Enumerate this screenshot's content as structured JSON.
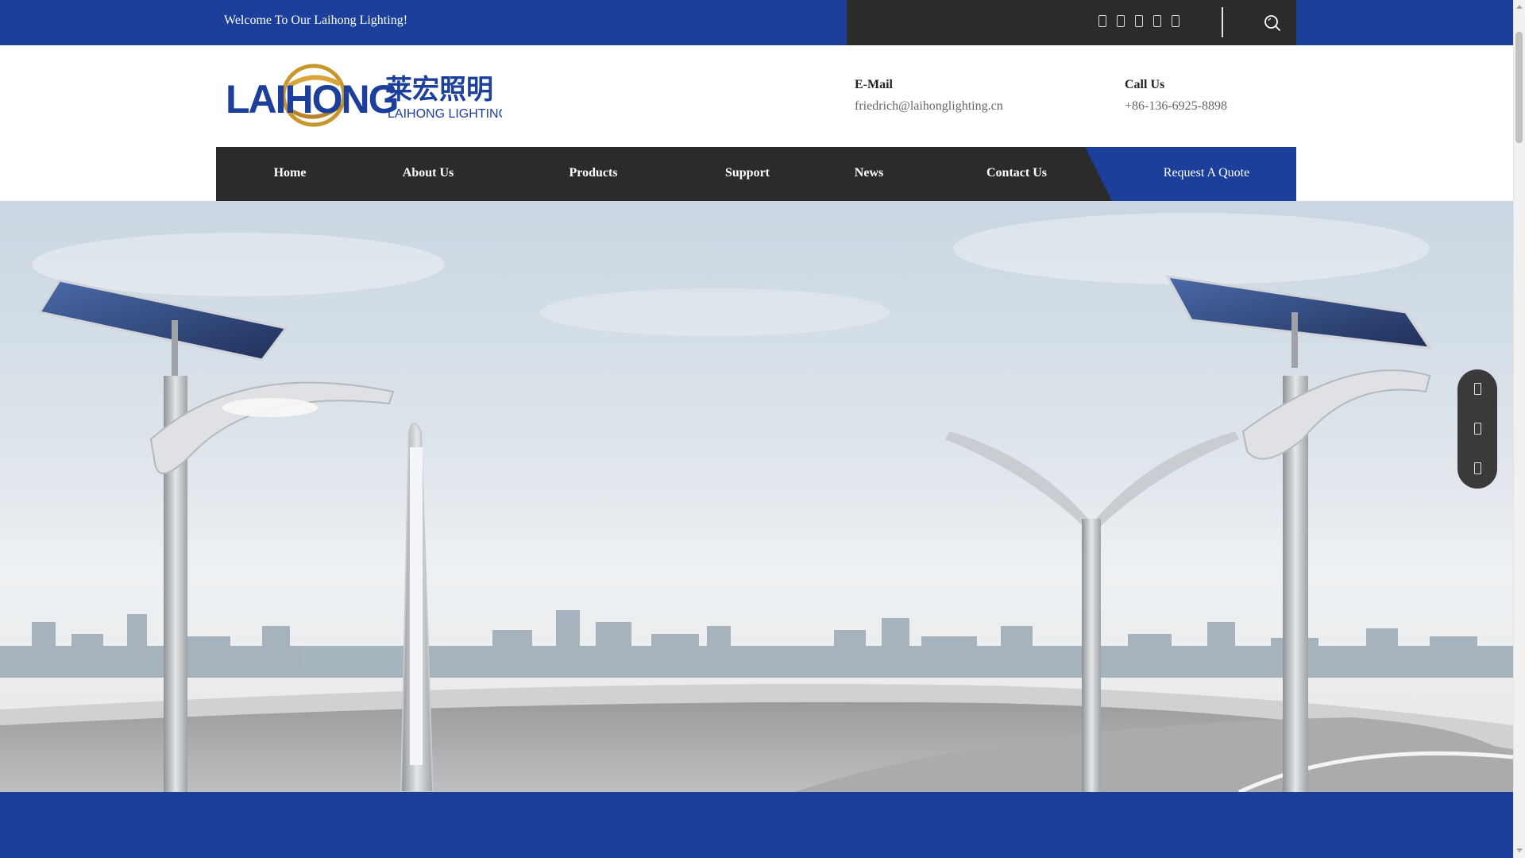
{
  "topbar": {
    "welcome": "Welcome To Our Laihong Lighting!",
    "social_icons": [
      "facebook-icon",
      "twitter-icon",
      "linkedin-icon",
      "youtube-icon",
      "instagram-icon"
    ],
    "search_icon": "search-icon"
  },
  "logo": {
    "brand_latin": "LAIHONG",
    "brand_chinese": "莱宏照明",
    "brand_sub": "LAIHONG LIGHTING"
  },
  "contact": {
    "email_label": "E-Mail",
    "email_value": "friedrich@laihonglighting.cn",
    "phone_label": "Call Us",
    "phone_value": "+86-136-6925-8898"
  },
  "nav": {
    "items": [
      {
        "label": "Home"
      },
      {
        "label": "About Us"
      },
      {
        "label": "Products"
      },
      {
        "label": "Support"
      },
      {
        "label": "News"
      },
      {
        "label": "Contact Us"
      }
    ],
    "quote_label": "Request A Quote"
  },
  "side_tools": [
    "email-icon",
    "phone-icon",
    "message-icon"
  ],
  "colors": {
    "brand_blue": "#1c3f9b",
    "dark_bar": "#2b2b2b",
    "logo_gold": "#c8962a"
  }
}
